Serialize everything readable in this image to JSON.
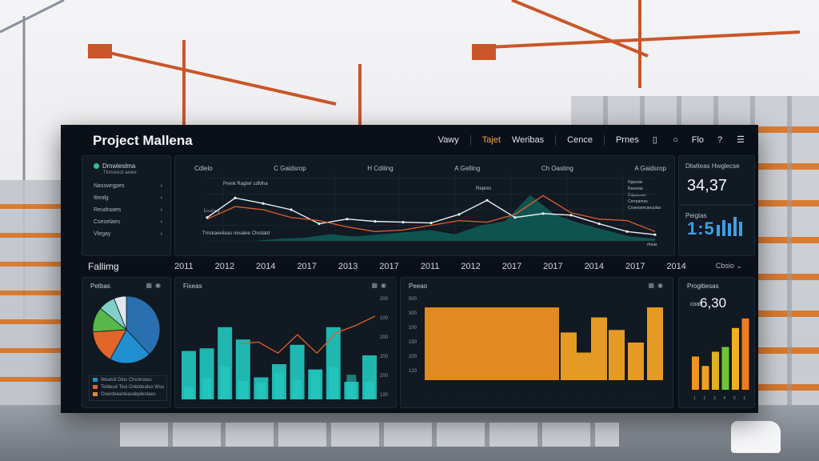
{
  "app": {
    "title": "Project Mallena"
  },
  "nav": {
    "items": [
      {
        "label": "Vawy",
        "active": false
      },
      {
        "label": "Tajet",
        "active": true
      },
      {
        "label": "Weribas",
        "active": false
      },
      {
        "label": "Cence",
        "active": false
      },
      {
        "label": "Prnes",
        "active": false
      }
    ],
    "extra_label": "Flo",
    "accent": "#f0a04a"
  },
  "sidebar": {
    "heading": "Dmwleslma",
    "subheading": "Tkmoreot aelee",
    "items": [
      {
        "label": "Nasswrgpes"
      },
      {
        "label": "Itiealg"
      },
      {
        "label": "Reudraaes"
      },
      {
        "label": "Cseoelaes"
      },
      {
        "label": "Vlegay"
      }
    ]
  },
  "line_panel": {
    "column_labels": [
      "Cdlelo",
      "C Gaidsrop",
      "H Cdiling",
      "A Gelling",
      "Ch Oasting",
      "A Gaidsrop"
    ],
    "annotations": {
      "top_left": "Prenk Raglwr cdMha",
      "mid_left": "Lrmhey",
      "peak": "Repres",
      "bottom": "Tmskaeeiteas nesalee Chcdatd",
      "bottom_right": "rheas"
    },
    "legend": [
      "Hgeesle",
      "Reeesta",
      "Ddpaunes",
      "Cerrpamas",
      "Coaessmcaeuulas"
    ]
  },
  "chart_data": [
    {
      "type": "area",
      "title": "",
      "series": [
        {
          "values": [
            6,
            5,
            6,
            7,
            5,
            6,
            8,
            6,
            4,
            8,
            9,
            16,
            9,
            8,
            11,
            2
          ]
        },
        {
          "values": [
            30,
            55,
            48,
            40,
            22,
            28,
            25,
            24,
            23,
            34,
            52,
            30,
            35,
            33,
            22,
            12,
            8
          ]
        },
        {
          "values": [
            28,
            44,
            40,
            30,
            26,
            18,
            12,
            14,
            20,
            26,
            24,
            34,
            58,
            36,
            28,
            26,
            12
          ]
        }
      ],
      "ylim": [
        0,
        80
      ]
    },
    {
      "type": "bar",
      "title": "Fixeas",
      "series": [
        {
          "values": [
            55,
            58,
            82,
            68,
            25,
            40,
            62,
            34,
            82,
            20,
            50
          ]
        },
        {
          "values": [
            28,
            48,
            74,
            42,
            38,
            60,
            44,
            66,
            74,
            56,
            40
          ]
        }
      ],
      "line_values": [
        60,
        62,
        50,
        70,
        50,
        72,
        80,
        90
      ],
      "y_ticks": [
        "200",
        "100",
        "200",
        "200",
        "200",
        "190"
      ]
    },
    {
      "type": "bar",
      "title": "Peeao",
      "values": [
        58,
        58,
        58,
        58,
        58,
        58,
        58,
        58,
        45,
        45,
        45,
        58,
        45,
        58
      ],
      "y_ticks": [
        "500",
        "300",
        "100",
        "150",
        "200",
        "120"
      ]
    },
    {
      "type": "bar",
      "title": "Progitiesas",
      "categories": [
        "1",
        "2",
        "3",
        "4",
        "5",
        "6"
      ],
      "values": [
        35,
        25,
        40,
        45,
        65,
        75
      ],
      "colors": [
        "#f0921f",
        "#f0a020",
        "#e0b020",
        "#6ec43a",
        "#f0b020",
        "#f07a1f"
      ]
    },
    {
      "type": "pie",
      "title": "Petbas",
      "slices": [
        {
          "value": 38,
          "color": "#2a6fb0"
        },
        {
          "value": 20,
          "color": "#1f8fd0"
        },
        {
          "value": 16,
          "color": "#e0652a"
        },
        {
          "value": 12,
          "color": "#58b74a"
        },
        {
          "value": 8,
          "color": "#7ed0c8"
        },
        {
          "value": 6,
          "color": "#dfe6ec"
        }
      ],
      "legend": [
        "Weatsil Dlos Chvorsoes",
        "Teldeud Tesl Orletdealso Wsu",
        "Oserdeearteasdeplestaes"
      ]
    }
  ],
  "kpis": {
    "kpi1": {
      "label": "Dtwiteas Hwglecse",
      "value": "34,37"
    },
    "kpi2": {
      "label": "Peigtas",
      "value": "1:5"
    },
    "kpi3": {
      "prefix": "coal",
      "value": "6,30"
    }
  },
  "year_row": {
    "label": "Fallimg",
    "years": [
      "2011",
      "2012",
      "2014",
      "2017",
      "2013",
      "2017",
      "2011",
      "2012",
      "2017",
      "2017",
      "2014",
      "2017",
      "2014"
    ],
    "dropdown": "Cbsio"
  },
  "panel_titles": {
    "pie": "Petbas",
    "bar1": "Fixeas",
    "bar2": "Peeao",
    "bar3": "Progitiesas"
  }
}
